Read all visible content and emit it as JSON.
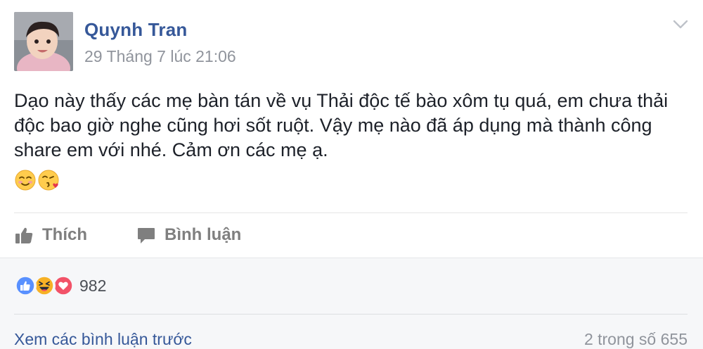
{
  "post": {
    "author": "Quynh Tran",
    "timestamp": "29 Tháng 7 lúc 21:06",
    "text": "Dạo này thấy các mẹ bàn tán về vụ Thải độc tế bào xôm tụ quá, em chưa thải độc bao giờ nghe cũng hơi sốt ruột. Vậy mẹ nào đã áp dụng mà thành công share em với nhé. Cảm ơn các mẹ ạ.",
    "emojis": [
      "smiling-face-icon",
      "kiss-face-icon"
    ]
  },
  "actions": {
    "like_label": "Thích",
    "comment_label": "Bình luận"
  },
  "reactions": {
    "types": [
      "like",
      "haha",
      "love"
    ],
    "count": "982"
  },
  "comments": {
    "view_previous": "Xem các bình luận trước",
    "pager": "2 trong số 655"
  },
  "colors": {
    "link": "#365899",
    "meta": "#90949c",
    "like": "#5890ff",
    "love": "#f25268",
    "haha": "#f7b125"
  }
}
